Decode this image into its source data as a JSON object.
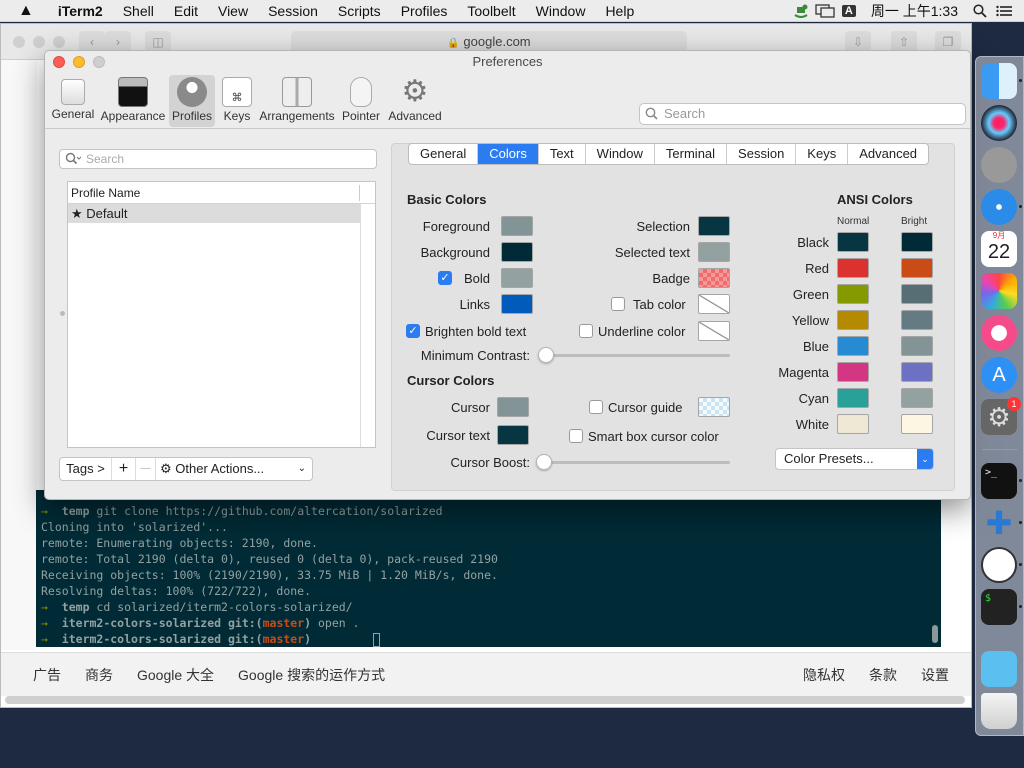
{
  "menubar": {
    "apple": "",
    "app_name": "iTerm2",
    "items": [
      "Shell",
      "Edit",
      "View",
      "Session",
      "Scripts",
      "Profiles",
      "Toolbelt",
      "Window",
      "Help"
    ],
    "input_method": "A",
    "clock": "周一 上午1:33"
  },
  "safari": {
    "url": "google.com",
    "footer_left": [
      "广告",
      "商务",
      "Google 大全",
      "Google 搜索的运作方式"
    ],
    "footer_right": [
      "隐私权",
      "条款",
      "设置"
    ]
  },
  "terminal": {
    "lines": [
      {
        "arrow": "→",
        "dir": "temp",
        "cmd": " git clone https://github.com/altercation/solarized"
      },
      {
        "text": "Cloning into 'solarized'..."
      },
      {
        "text": "remote: Enumerating objects: 2190, done."
      },
      {
        "text": "remote: Total 2190 (delta 0), reused 0 (delta 0), pack-reused 2190"
      },
      {
        "text": "Receiving objects: 100% (2190/2190), 33.75 MiB | 1.20 MiB/s, done."
      },
      {
        "text": "Resolving deltas: 100% (722/722), done."
      },
      {
        "arrow": "→",
        "dir": "temp",
        "cmd": " cd solarized/iterm2-colors-solarized/"
      },
      {
        "arrow": "→",
        "dir": "iterm2-colors-solarized",
        "git": " git:(",
        "branch": "master",
        "close": ")",
        "cmd": " open ."
      },
      {
        "arrow": "→",
        "dir": "iterm2-colors-solarized",
        "git": " git:(",
        "branch": "master",
        "close": ")",
        "cmd": " "
      }
    ]
  },
  "prefs": {
    "title": "Preferences",
    "toolbar": [
      "General",
      "Appearance",
      "Profiles",
      "Keys",
      "Arrangements",
      "Pointer",
      "Advanced"
    ],
    "search_placeholder": "Search",
    "profile_search_placeholder": "Search",
    "profile_list_header": "Profile Name",
    "profiles": [
      "Default"
    ],
    "profile_star": "★",
    "tags_button": "Tags >",
    "add_button": "+",
    "remove_button": "—",
    "other_actions": "Other Actions...",
    "tabs": [
      "General",
      "Colors",
      "Text",
      "Window",
      "Terminal",
      "Session",
      "Keys",
      "Advanced"
    ],
    "active_tab": "Colors",
    "basic_colors_heading": "Basic Colors",
    "cursor_colors_heading": "Cursor Colors",
    "ansi_heading": "ANSI Colors",
    "normal_label": "Normal",
    "bright_label": "Bright",
    "foreground": "Foreground",
    "background": "Background",
    "bold": "Bold",
    "links": "Links",
    "selection": "Selection",
    "selected_text": "Selected text",
    "badge": "Badge",
    "tab_color": "Tab color",
    "brighten_bold": "Brighten bold text",
    "underline_color": "Underline color",
    "min_contrast": "Minimum Contrast:",
    "cursor": "Cursor",
    "cursor_text": "Cursor text",
    "cursor_guide": "Cursor guide",
    "smart_box": "Smart box cursor color",
    "cursor_boost": "Cursor Boost:",
    "color_presets": "Color Presets...",
    "colors": {
      "foreground": "#839496",
      "background": "#002b36",
      "bold": "#93a1a1",
      "links": "#005bbb",
      "selection": "#073642",
      "selected_text": "#93a1a1",
      "badge": "#f07070",
      "cursor": "#839496",
      "cursor_text": "#073642"
    },
    "ansi": [
      {
        "name": "Black",
        "normal": "#073642",
        "bright": "#002b36"
      },
      {
        "name": "Red",
        "normal": "#dc322f",
        "bright": "#cb4b16"
      },
      {
        "name": "Green",
        "normal": "#859900",
        "bright": "#586e75"
      },
      {
        "name": "Yellow",
        "normal": "#b58900",
        "bright": "#657b83"
      },
      {
        "name": "Blue",
        "normal": "#268bd2",
        "bright": "#839496"
      },
      {
        "name": "Magenta",
        "normal": "#d33682",
        "bright": "#6c71c4"
      },
      {
        "name": "Cyan",
        "normal": "#2aa198",
        "bright": "#93a1a1"
      },
      {
        "name": "White",
        "normal": "#eee8d5",
        "bright": "#fdf6e3"
      }
    ],
    "checked": {
      "bold": true,
      "brighten_bold": true,
      "tab_color": false,
      "underline_color": false,
      "cursor_guide": false,
      "smart_box": false
    },
    "min_contrast_value": 0,
    "cursor_boost_value": 0
  },
  "dock": {
    "calendar_month": "9月",
    "calendar_day": "22",
    "badge_count": "1"
  }
}
